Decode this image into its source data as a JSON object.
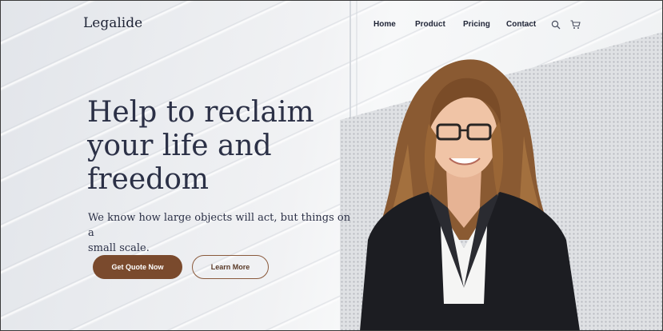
{
  "brand": {
    "name": "Legalide"
  },
  "nav": {
    "items": [
      {
        "label": "Home"
      },
      {
        "label": "Product"
      },
      {
        "label": "Pricing"
      },
      {
        "label": "Contact"
      }
    ],
    "icons": [
      "search-icon",
      "cart-icon"
    ]
  },
  "hero": {
    "headline_line1": "Help to reclaim",
    "headline_line2": "your life and",
    "headline_line3": "freedom",
    "subtext_line1": "We know how large objects will act, but things on a",
    "subtext_line2": "small scale.",
    "primary_button": "Get Quote Now",
    "secondary_button": "Learn More"
  },
  "colors": {
    "accent": "#7a4a2d",
    "heading": "#2b3046",
    "background": "#eceef1"
  }
}
